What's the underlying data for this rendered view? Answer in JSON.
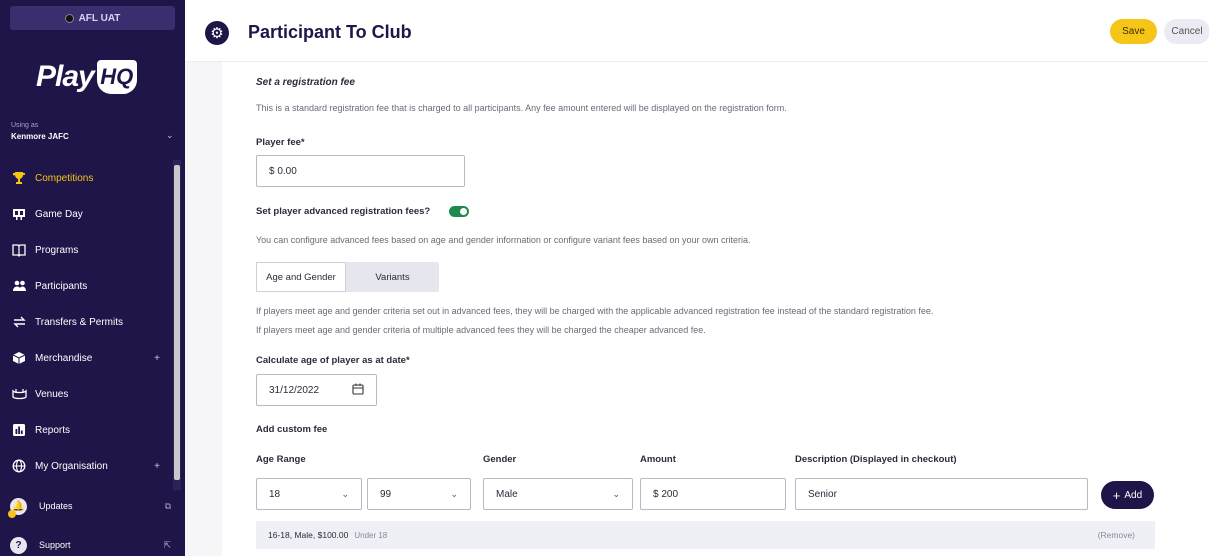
{
  "sidebar": {
    "environment": "AFL UAT",
    "logo_text": "Play",
    "logo_hq": "HQ",
    "using_as_label": "Using as",
    "organisation": "Kenmore JAFC",
    "items": [
      {
        "label": "Competitions",
        "icon": "trophy-icon",
        "active": true
      },
      {
        "label": "Game Day",
        "icon": "scoreboard-icon"
      },
      {
        "label": "Programs",
        "icon": "book-icon"
      },
      {
        "label": "Participants",
        "icon": "people-icon"
      },
      {
        "label": "Transfers & Permits",
        "icon": "transfer-arrows-icon"
      },
      {
        "label": "Merchandise",
        "icon": "box-icon",
        "expandable": true
      },
      {
        "label": "Venues",
        "icon": "stadium-icon"
      },
      {
        "label": "Reports",
        "icon": "chart-icon"
      },
      {
        "label": "My Organisation",
        "icon": "globe-icon",
        "expandable": true
      }
    ],
    "bottom": [
      {
        "label": "Updates",
        "icon": "bell-icon"
      },
      {
        "label": "Support",
        "icon": "help-icon"
      }
    ],
    "accent_color": "#f5c518",
    "background_color": "#1f1548"
  },
  "header": {
    "title": "Participant To Club",
    "save_label": "Save",
    "cancel_label": "Cancel"
  },
  "form": {
    "section_title": "Set a registration fee",
    "section_desc": "This is a standard registration fee that is charged to all participants. Any fee amount entered will be displayed on the registration form.",
    "player_fee_label": "Player fee*",
    "player_fee_value": "$ 0.00",
    "advanced_toggle_label": "Set player advanced registration fees?",
    "advanced_toggle_on": true,
    "advanced_desc": "You can configure advanced fees based on age and gender information or configure variant fees based on your own criteria.",
    "tabs": [
      "Age and Gender",
      "Variants"
    ],
    "info_line_1": "If players meet age and gender criteria set out in advanced fees, they will be charged with the applicable advanced registration fee instead of the standard registration fee.",
    "info_line_2": "If players meet age and gender criteria of multiple advanced fees they will be charged the cheaper advanced fee.",
    "age_date_label": "Calculate age of player as at date*",
    "age_date_value": "31/12/2022",
    "custom_fee_title": "Add custom fee",
    "age_range_label": "Age Range",
    "age_from": "18",
    "age_to": "99",
    "gender_label": "Gender",
    "gender_value": "Male",
    "amount_label": "Amount",
    "amount_value": "$ 200",
    "description_label": "Description (Displayed in checkout)",
    "description_value": "Senior",
    "add_label": "Add",
    "existing_fees": [
      {
        "summary": "16-18, Male, $100.00",
        "description": "Under 18",
        "remove_label": "(Remove)"
      }
    ]
  }
}
